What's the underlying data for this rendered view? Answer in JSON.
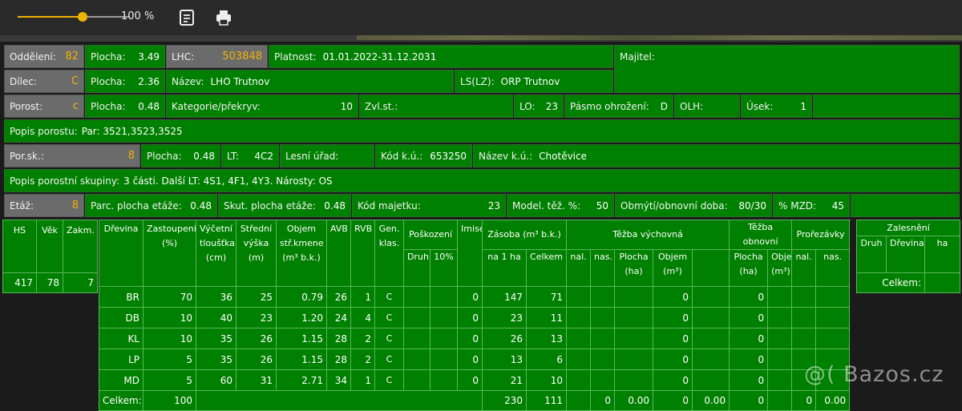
{
  "toolbar": {
    "zoom_label": "100 %",
    "zoom_fraction": 0.58,
    "icons": [
      "notes-icon",
      "print-icon"
    ],
    "accent_color": "#f0b400"
  },
  "info": {
    "oddeleni_label": "Oddělení:",
    "oddeleni": "82",
    "plocha1_label": "Plocha:",
    "plocha1": "3.49",
    "lhc_label": "LHC:",
    "lhc": "503848",
    "platnost_label": "Platnost:",
    "platnost": "01.01.2022-31.12.2031",
    "majitel_label": "Majitel:",
    "dilec_label": "Dílec:",
    "dilec": "C",
    "plocha2_label": "Plocha:",
    "plocha2": "2.36",
    "nazev_label": "Název:",
    "nazev": "LHO Trutnov",
    "ls_label": "LS(LZ):",
    "ls": "ORP Trutnov",
    "porost_label": "Porost:",
    "porost": "c",
    "plocha3_label": "Plocha:",
    "plocha3": "0.48",
    "kategorie_label": "Kategorie/překryv:",
    "kategorie": "10",
    "zvlst_label": "Zvl.st.:",
    "lo_label": "LO:",
    "lo": "23",
    "pasmo_label": "Pásmo ohrožení:",
    "pasmo": "D",
    "olh_label": "OLH:",
    "usek_label": "Úsek:",
    "usek": "1",
    "popis_porostu_label": "Popis porostu:",
    "popis_porostu": "Par: 3521,3523,3525",
    "porsk_label": "Por.sk.:",
    "porsk": "8",
    "plocha4_label": "Plocha:",
    "plocha4": "0.48",
    "lt_label": "LT:",
    "lt": "4C2",
    "lesni_urad_label": "Lesní úřad:",
    "kod_ku_label": "Kód k.ú.:",
    "kod_ku": "653250",
    "nazev_ku_label": "Název k.ú.:",
    "nazev_ku": "Chotěvice",
    "popis_skupiny_label": "Popis porostní skupiny:",
    "popis_skupiny": "3 části. Další LT: 4S1, 4F1, 4Y3. Nárosty: OS",
    "etaz_label": "Etáž:",
    "etaz": "8",
    "parc_label": "Parc. plocha etáže:",
    "parc": "0.48",
    "skut_label": "Skut. plocha etáže:",
    "skut": "0.48",
    "kod_majetku_label": "Kód majetku:",
    "kod_majetku": "23",
    "model_label": "Model. těž. %:",
    "model": "50",
    "obmyti_label": "Obmýtí/obnovní doba:",
    "obmyti": "80/30",
    "mzd_label": "% MZD:",
    "mzd": "45"
  },
  "left_table": {
    "headers": [
      "HS",
      "Věk",
      "Zakm."
    ],
    "row": [
      "417",
      "78",
      "7"
    ]
  },
  "main_table": {
    "h_drevina": "Dřevina",
    "h_zastoupeni": "Zastoupení (%)",
    "h_vycetni": "Výčetní tloušťka (cm)",
    "h_stredni": "Střední výška (m)",
    "h_objem": "Objem stř.kmene (m³ b.k.)",
    "h_avb": "AVB",
    "h_rvb": "RVB",
    "h_gen": "Gen. klas.",
    "h_poskozeni": "Poškození",
    "h_druh": "Druh",
    "h_10": "10%",
    "h_imise": "Imise",
    "h_zasoba": "Zásoba (m³ b.k.)",
    "h_na1ha": "na 1 ha",
    "h_celkem": "Celkem",
    "h_tezba_vych": "Těžba výchovná",
    "h_tezba_obn": "Těžba obnovní",
    "h_prorezavky": "Prořezávky",
    "h_nal": "nal.",
    "h_nas": "nas.",
    "h_plocha_ha": "Plocha (ha)",
    "h_objem_m3": "Objem (m³)",
    "rows": [
      [
        "BR",
        "70",
        "36",
        "25",
        "0.79",
        "26",
        "1",
        "C",
        "",
        "",
        "0",
        "147",
        "71",
        "",
        "",
        "",
        "0",
        "",
        "0",
        "",
        "",
        ""
      ],
      [
        "DB",
        "10",
        "40",
        "23",
        "1.20",
        "24",
        "4",
        "C",
        "",
        "",
        "0",
        "23",
        "11",
        "",
        "",
        "",
        "0",
        "",
        "0",
        "",
        "",
        ""
      ],
      [
        "KL",
        "10",
        "35",
        "26",
        "1.15",
        "28",
        "2",
        "C",
        "",
        "",
        "0",
        "26",
        "13",
        "",
        "",
        "",
        "0",
        "",
        "0",
        "",
        "",
        ""
      ],
      [
        "LP",
        "5",
        "35",
        "26",
        "1.15",
        "28",
        "2",
        "C",
        "",
        "",
        "0",
        "13",
        "6",
        "",
        "",
        "",
        "0",
        "",
        "0",
        "",
        "",
        ""
      ],
      [
        "MD",
        "5",
        "60",
        "31",
        "2.71",
        "34",
        "1",
        "C",
        "",
        "",
        "0",
        "21",
        "10",
        "",
        "",
        "",
        "0",
        "",
        "0",
        "",
        "",
        ""
      ]
    ],
    "total_label": "Celkem:",
    "total": {
      "zastoupeni": "100",
      "na1ha": "230",
      "celkem": "111",
      "tv_nas": "0",
      "tv_plocha": "0.00",
      "tv_objem": "0",
      "to_plocha": "0.00",
      "to_objem": "0",
      "pr_nas": "0",
      "pr_plocha": "0.00"
    }
  },
  "zalesneni": {
    "title": "Zalesnění",
    "headers": [
      "Druh",
      "Dřevina",
      "ha"
    ],
    "total_label": "Celkem:"
  },
  "watermark": "@( Bazos.cz"
}
